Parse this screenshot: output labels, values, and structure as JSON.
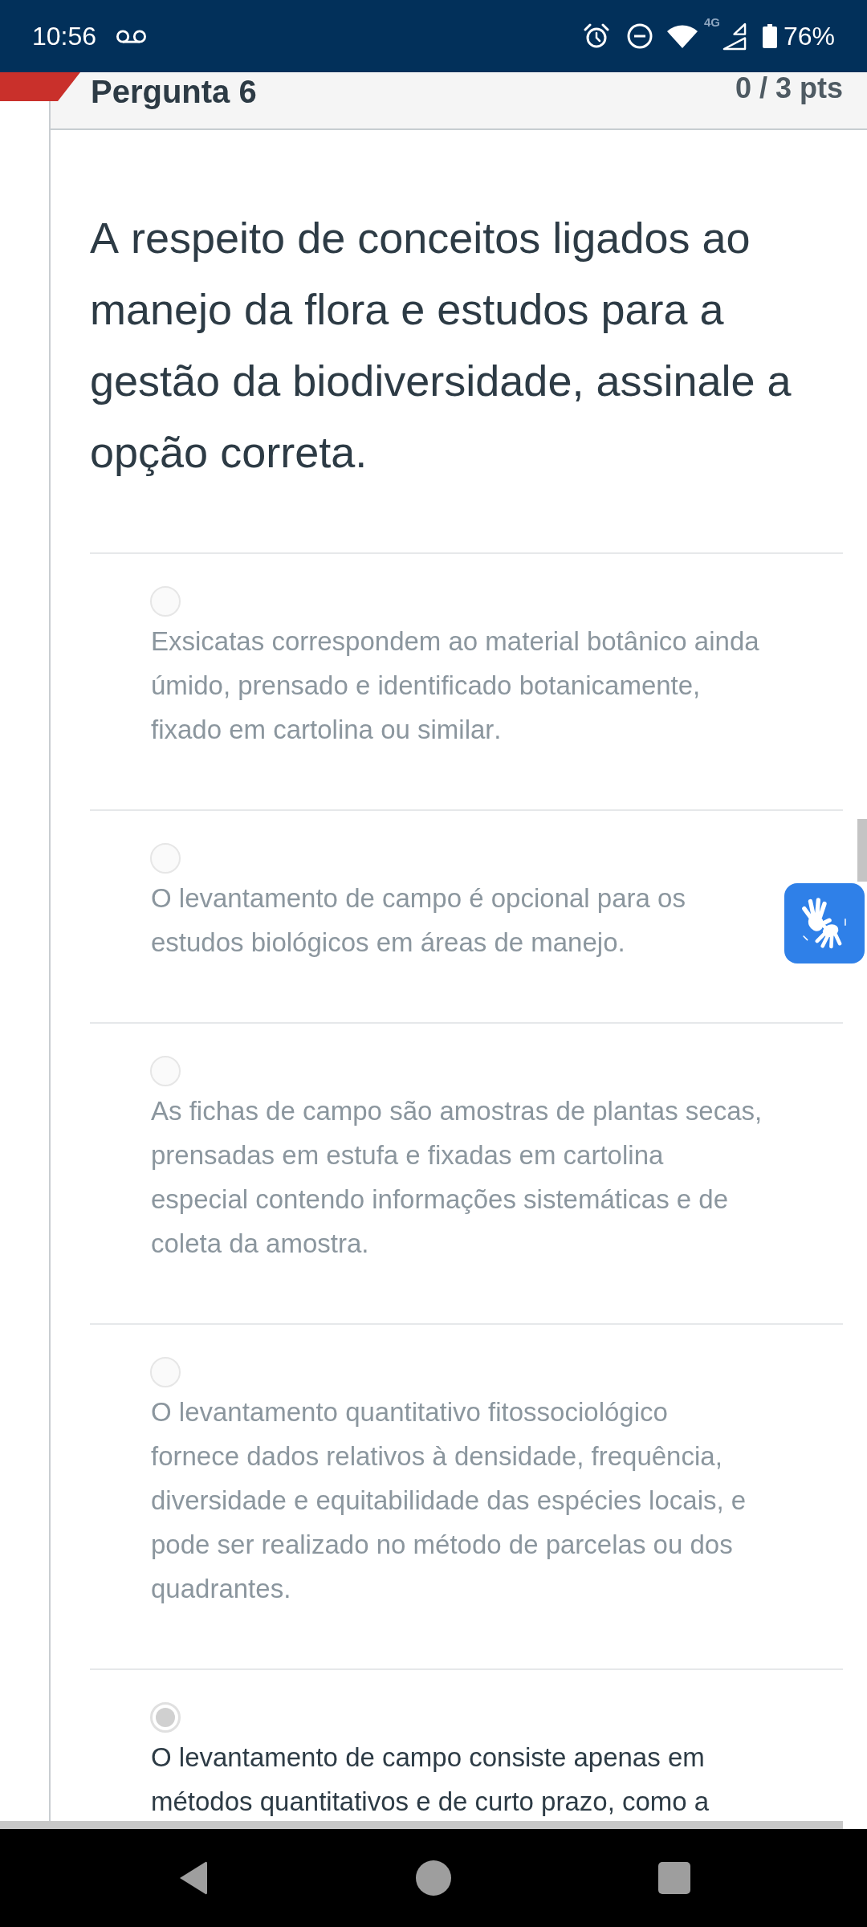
{
  "status_bar": {
    "time": "10:56",
    "network": "4G",
    "battery": "76%"
  },
  "question": {
    "title": "Pergunta 6",
    "points": "0 / 3 pts",
    "text": "A respeito de conceitos ligados ao manejo da flora e estudos para a gestão da biodiversidade, assinale a opção correta."
  },
  "answers": [
    {
      "text": "Exsicatas correspondem ao material botânico ainda úmido, prensado e identificado botanicamente, fixado em cartolina ou similar.",
      "selected": false
    },
    {
      "text": "O levantamento de campo é opcional para os estudos biológicos em áreas de manejo.",
      "selected": false
    },
    {
      "text": "As fichas de campo são amostras de plantas secas, prensadas em estufa e fixadas em cartolina especial contendo informações sistemáticas e de coleta da amostra.",
      "selected": false
    },
    {
      "text": "O levantamento quantitativo fitossociológico fornece dados relativos à densidade, frequência, diversidade e equitabilidade das espécies locais, e pode ser realizado no método de parcelas ou dos quadrantes.",
      "selected": false
    },
    {
      "text": "O levantamento de campo consiste apenas em métodos quantitativos e de curto prazo, como a",
      "selected": true
    }
  ]
}
